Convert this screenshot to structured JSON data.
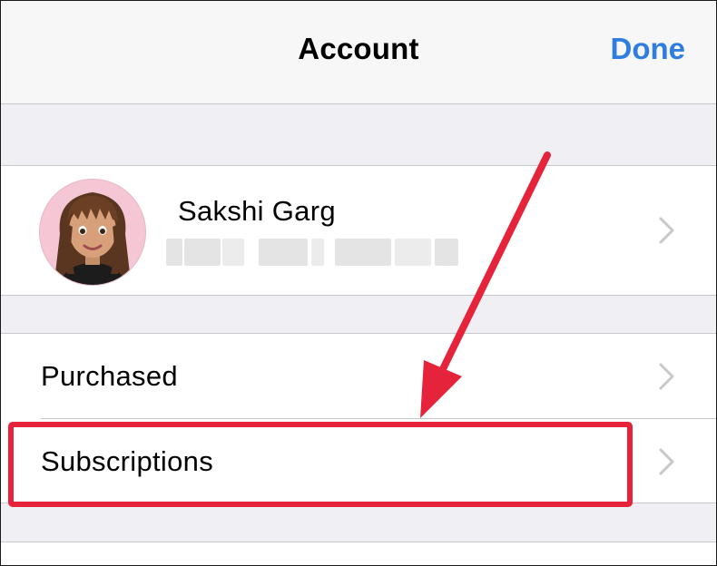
{
  "nav": {
    "title": "Account",
    "done_label": "Done",
    "done_color": "#2f7de1"
  },
  "profile": {
    "name": "Sakshi Garg",
    "email_blurred": true
  },
  "list": {
    "items": [
      {
        "label": "Purchased"
      },
      {
        "label": "Subscriptions"
      }
    ]
  },
  "annotation": {
    "highlighted_item": "Subscriptions",
    "color": "#e5233a"
  },
  "icons": [
    "chevron-right-icon",
    "memoji-avatar"
  ]
}
